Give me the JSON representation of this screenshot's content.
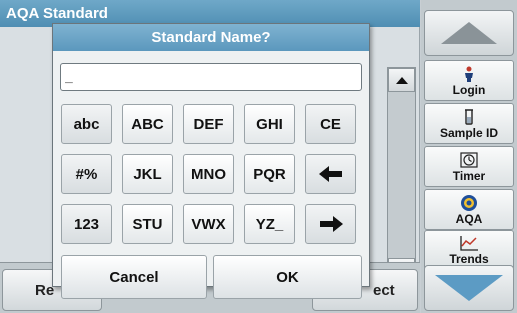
{
  "app": {
    "title": "AQA Standard",
    "bottom_left_label": "Re",
    "bottom_right_label": "ect"
  },
  "side_panel": {
    "buttons": [
      {
        "label": "Login",
        "icon": "person-icon"
      },
      {
        "label": "Sample ID",
        "icon": "beaker-icon"
      },
      {
        "label": "Timer",
        "icon": "timer-icon"
      },
      {
        "label": "AQA",
        "icon": "aqa-icon"
      },
      {
        "label": "Trends",
        "icon": "trends-icon"
      }
    ]
  },
  "dialog": {
    "title": "Standard Name?",
    "input_value": "_",
    "keys": {
      "row1": [
        "abc",
        "ABC",
        "DEF",
        "GHI",
        "CE"
      ],
      "row2": [
        "#%",
        "JKL",
        "MNO",
        "PQR"
      ],
      "row3": [
        "123",
        "STU",
        "VWX",
        "YZ_"
      ]
    },
    "cancel_label": "Cancel",
    "ok_label": "OK"
  },
  "colors": {
    "title_bar": "#5b98bd",
    "nav_down_arrow": "#5c9bc4",
    "dialog_bg": "#eef1f2"
  }
}
